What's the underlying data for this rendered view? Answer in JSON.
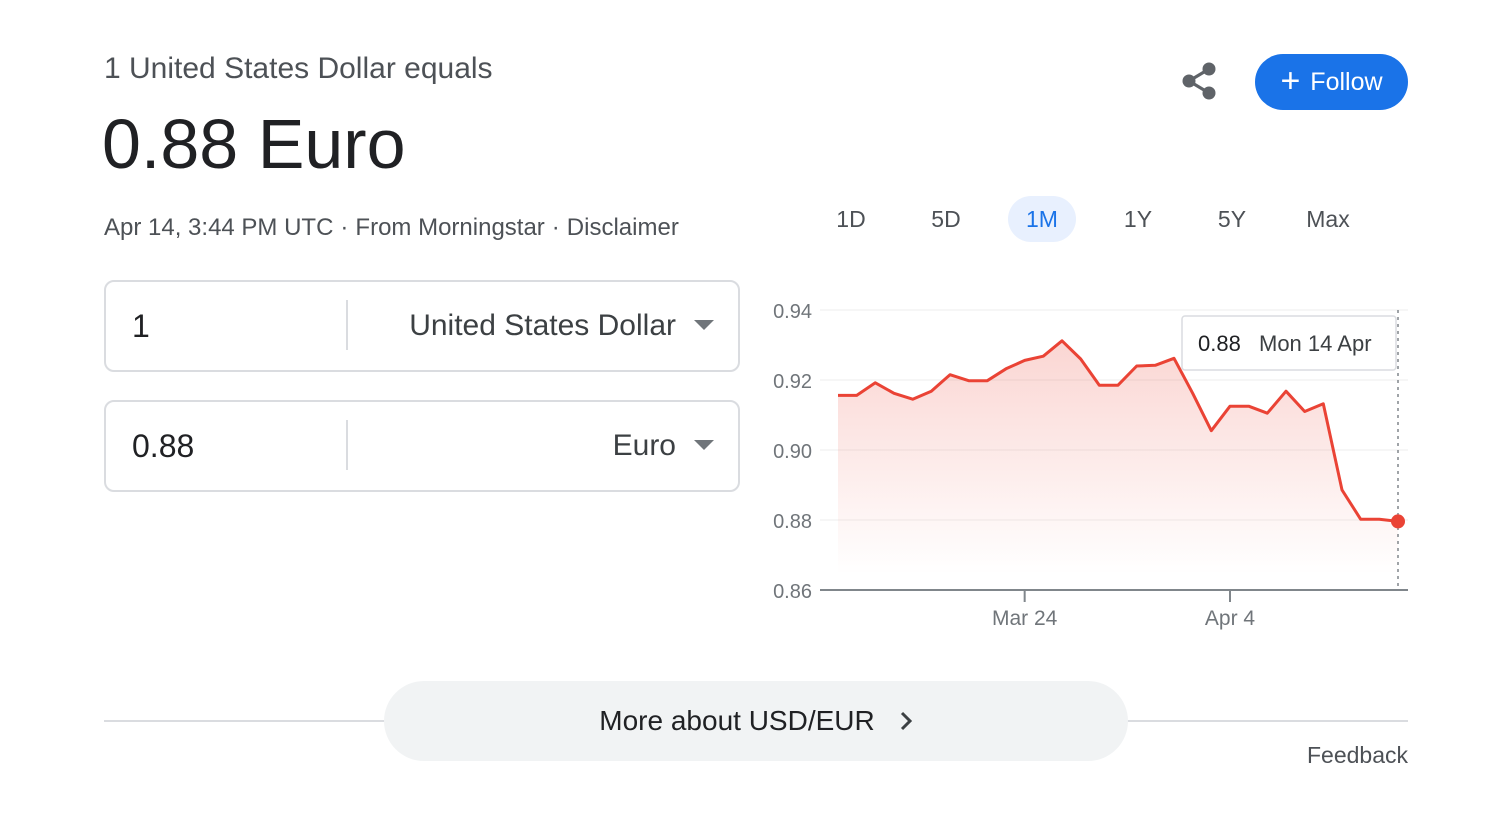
{
  "header": {
    "subtitle": "1 United States Dollar equals",
    "headline": "0.88 Euro",
    "timestamp": "Apr 14, 3:44 PM UTC",
    "source": "From Morningstar",
    "disclaimer": "Disclaimer",
    "separator": "·"
  },
  "actions": {
    "share_icon": "share-icon",
    "follow_plus": "+",
    "follow_label": "Follow",
    "accent_color": "#1a73e8"
  },
  "converter": {
    "from_amount": "1",
    "from_currency": "United States Dollar",
    "to_amount": "0.88",
    "to_currency": "Euro"
  },
  "range_tabs": {
    "items": [
      "1D",
      "5D",
      "1M",
      "1Y",
      "5Y",
      "Max"
    ],
    "active": "1M"
  },
  "tooltip": {
    "value": "0.88",
    "date": "Mon 14 Apr"
  },
  "chart_data": {
    "type": "line",
    "series_color": "#ea4335",
    "yticks": [
      "0.94",
      "0.92",
      "0.90",
      "0.88",
      "0.86"
    ],
    "ylim": [
      0.86,
      0.94
    ],
    "xticks": [
      {
        "label": "Mar 24",
        "index": 10
      },
      {
        "label": "Apr 4",
        "index": 21
      }
    ],
    "values": [
      0.9156,
      0.9156,
      0.9192,
      0.9162,
      0.9145,
      0.9168,
      0.9215,
      0.9198,
      0.9198,
      0.9232,
      0.9256,
      0.9268,
      0.9312,
      0.926,
      0.9185,
      0.9185,
      0.924,
      0.9242,
      0.9262,
      0.9162,
      0.9055,
      0.9125,
      0.9125,
      0.9105,
      0.9168,
      0.911,
      0.9132,
      0.8886,
      0.8802,
      0.8802,
      0.8796
    ],
    "grid": true
  },
  "footer": {
    "more_label": "More about USD/EUR",
    "feedback": "Feedback"
  }
}
